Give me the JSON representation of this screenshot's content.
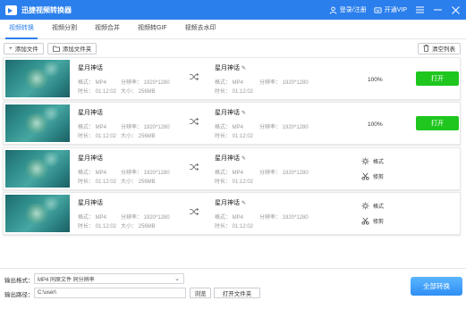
{
  "titlebar": {
    "app_title": "迅捷视频转换器",
    "login": "登录/注册",
    "vip": "开通VIP"
  },
  "tabs": [
    {
      "label": "视频转换",
      "active": true
    },
    {
      "label": "视频分割",
      "active": false
    },
    {
      "label": "视频合并",
      "active": false
    },
    {
      "label": "视频转GIF",
      "active": false
    },
    {
      "label": "视频去水印",
      "active": false
    }
  ],
  "toolbar": {
    "add_file": "添加文件",
    "add_folder": "添加文件夹",
    "clear_list": "清空列表"
  },
  "rows": [
    {
      "src": {
        "name": "星月神话",
        "format": "格式： MP4",
        "resolution": "分辨率： 1920*1280",
        "duration": "时长： 01:12:02",
        "size": "大小： 256MB"
      },
      "out": {
        "name": "星月神话",
        "format": "格式： MP4",
        "resolution": "分辨率： 1920*1280",
        "duration": "时长： 01:12:02"
      },
      "progress_text": "100%",
      "open_label": "打开"
    },
    {
      "src": {
        "name": "星月神话",
        "format": "格式： MP4",
        "resolution": "分辨率： 1920*1280",
        "duration": "时长： 01:12:02",
        "size": "大小： 256MB"
      },
      "out": {
        "name": "星月神话",
        "format": "格式： MP4",
        "resolution": "分辨率： 1920*1280",
        "duration": "时长： 01:12:02"
      },
      "progress_text": "100%",
      "open_label": "打开"
    },
    {
      "src": {
        "name": "星月神话",
        "format": "格式： MP4",
        "resolution": "分辨率： 1920*1280",
        "duration": "时长： 01:12:02",
        "size": "大小： 256MB"
      },
      "out": {
        "name": "星月神话",
        "format": "格式： MP4",
        "resolution": "分辨率： 1920*1280",
        "duration": "时长： 01:12:02"
      },
      "format_label": "格式",
      "trim_label": "修剪"
    },
    {
      "src": {
        "name": "星月神话",
        "format": "格式： MP4",
        "resolution": "分辨率： 1920*1280",
        "duration": "时长： 01:12:02",
        "size": "大小： 256MB"
      },
      "out": {
        "name": "星月神话",
        "format": "格式： MP4",
        "resolution": "分辨率： 1920*1280",
        "duration": "时长： 01:12:02"
      },
      "format_label": "格式",
      "trim_label": "修剪"
    }
  ],
  "bottom": {
    "output_format_label": "输出格式：",
    "output_format_value": "MP4  同原文件 同分辨率",
    "output_path_label": "输出路径：",
    "output_path_value": "C:\\user\\",
    "browse_label": "浏览",
    "open_folder_label": "打开文件夹",
    "convert_all_label": "全部转换"
  },
  "colors": {
    "accent": "#2b7fec",
    "open_button": "#1ec61e",
    "convert_all": "#3f9bf7"
  }
}
